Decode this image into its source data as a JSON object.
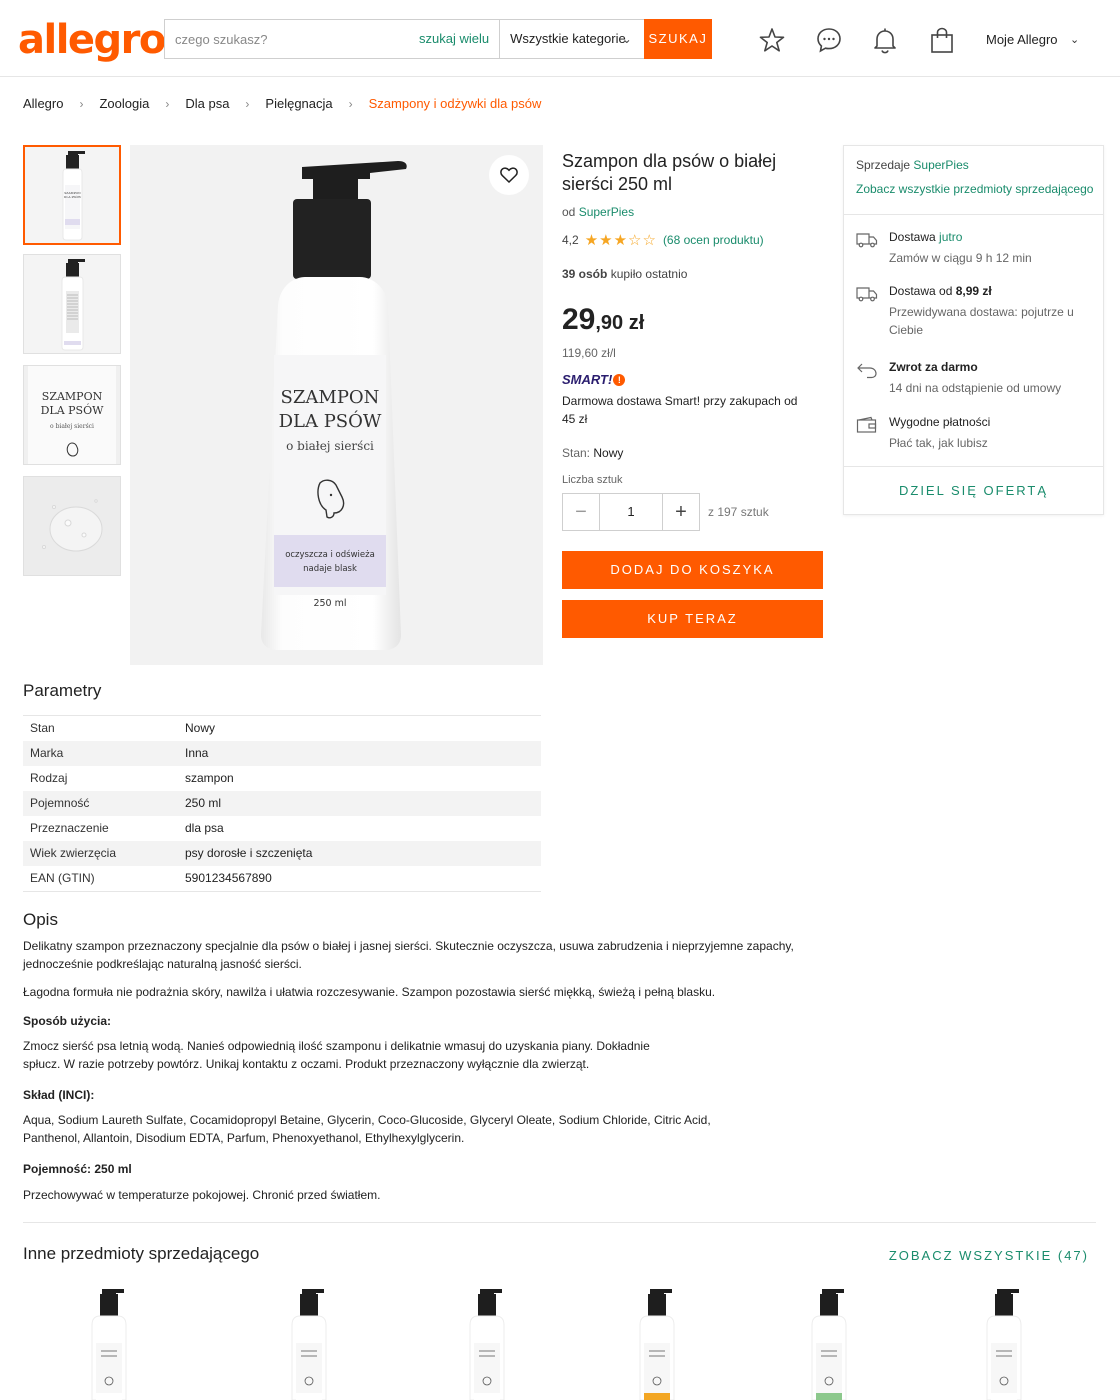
{
  "brand": {
    "logo": "allegro",
    "accent": "#ff5a00",
    "green": "#1a8c6c"
  },
  "header": {
    "search_placeholder": "czego szukasz?",
    "search_many": "szukaj wielu",
    "category": "Wszystkie kategorie",
    "search_button": "SZUKAJ",
    "icons": [
      "star-icon",
      "chat-icon",
      "bell-icon",
      "bag-icon"
    ],
    "account": "Moje Allegro"
  },
  "breadcrumb": [
    "Allegro",
    "Zoologia",
    "Dla psa",
    "Pielęgnacja",
    "Szampony i odżywki dla psów"
  ],
  "gallery": {
    "label_line1": "SZAMPON",
    "label_line2": "DLA PSÓW",
    "label_sub": "o białej sierści",
    "label_band_line1": "oczyszcza i odświeża",
    "label_band_line2": "nadaje blask",
    "label_volume": "250 ml",
    "band_color": "#e0dcef"
  },
  "product": {
    "title": "Szampon dla psów o białej sierści 250 ml",
    "by_prefix": "od",
    "seller": "SuperPies",
    "rating": "4,2",
    "rating_value": 4.2,
    "reviews": "(68 ocen produktu)",
    "bought_count": "39 osób",
    "bought_text": "kupiło ostatnio",
    "price_main": "29",
    "price_fraction": ",90 zł",
    "unit_price": "119,60 zł/l",
    "smart_label": "SMART!",
    "smart_info": "Darmowa dostawa Smart! przy zakupach od 45 zł",
    "condition_label": "Stan:",
    "condition": "Nowy",
    "qty_label": "Liczba sztuk",
    "qty_value": "1",
    "qty_available": "z 197 sztuk",
    "add_to_cart": "DODAJ DO KOSZYKA",
    "buy_now": "KUP TERAZ"
  },
  "seller_box": {
    "sold_by": "Sprzedaje",
    "seller": "SuperPies",
    "all_items": "Zobacz wszystkie przedmioty sprzedającego",
    "items": [
      {
        "icon": "truck-icon",
        "title": "Dostawa",
        "title_accent": "jutro",
        "sub": "Zamów w ciągu 9 h 12 min"
      },
      {
        "icon": "truck-icon",
        "title": "Dostawa od",
        "title_bold": "8,99 zł",
        "sub": "Przewidywana dostawa: pojutrze u Ciebie"
      },
      {
        "icon": "return-icon",
        "title": "Zwrot za darmo",
        "sub": "14 dni na odstąpienie od umowy"
      },
      {
        "icon": "wallet-icon",
        "title": "Wygodne płatności",
        "sub": "Płać tak, jak lubisz"
      }
    ],
    "share": "DZIEL SIĘ OFERTĄ"
  },
  "params": {
    "title": "Parametry",
    "rows": [
      {
        "k": "Stan",
        "v": "Nowy"
      },
      {
        "k": "Marka",
        "v": "Inna"
      },
      {
        "k": "Rodzaj",
        "v": "szampon"
      },
      {
        "k": "Pojemność",
        "v": "250 ml"
      },
      {
        "k": "Przeznaczenie",
        "v": "dla psa"
      },
      {
        "k": "Wiek zwierzęcia",
        "v": "psy dorosłe i szczenięta"
      },
      {
        "k": "EAN (GTIN)",
        "v": "5901234567890"
      }
    ]
  },
  "description": {
    "title": "Opis",
    "p1": "Delikatny szampon przeznaczony specjalnie dla psów o białej i jasnej sierści. Skutecznie oczyszcza, usuwa zabrudzenia i nieprzyjemne zapachy, jednocześnie podkreślając naturalną jasność sierści.",
    "p2": "Łagodna formuła nie podrażnia skóry, nawilża i ułatwia rozczesywanie. Szampon pozostawia sierść miękką, świeżą i pełną blasku.",
    "usage_title": "Sposób użycia:",
    "usage": "Zmocz sierść psa letnią wodą. Nanieś odpowiednią ilość szamponu i delikatnie wmasuj do uzyskania piany. Dokładnie spłucz. W razie potrzeby powtórz. Unikaj kontaktu z oczami. Produkt przeznaczony wyłącznie dla zwierząt.",
    "inci_title": "Skład (INCI):",
    "inci": "Aqua, Sodium Laureth Sulfate, Cocamidopropyl Betaine, Glycerin, Coco-Glucoside, Glyceryl Oleate, Sodium Chloride, Citric Acid, Panthenol, Allantoin, Disodium EDTA, Parfum, Phenoxyethanol, Ethylhexylglycerin.",
    "volume_title": "Pojemność: 250 ml",
    "storage": "Przechowywać w temperaturze pokojowej. Chronić przed światłem."
  },
  "other": {
    "title": "Inne przedmioty sprzedającego",
    "see_all": "ZOBACZ WSZYSTKIE (47)",
    "band_colors": [
      "#ffffff",
      "#ffffff",
      "#ffffff",
      "#f3a623",
      "#8cc88c",
      "#ffffff"
    ]
  }
}
